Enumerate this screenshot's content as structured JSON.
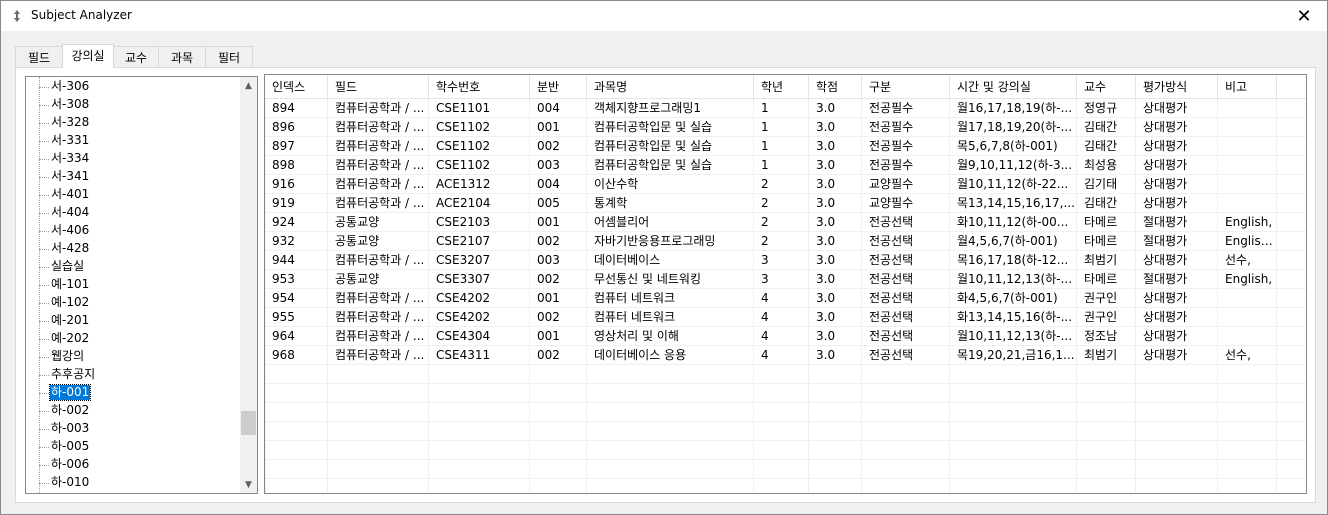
{
  "window": {
    "title": "Subject Analyzer",
    "close_glyph": "✕"
  },
  "tabs": [
    {
      "label": "필드"
    },
    {
      "label": "강의실"
    },
    {
      "label": "교수"
    },
    {
      "label": "과목"
    },
    {
      "label": "필터"
    }
  ],
  "tree": {
    "items": [
      "서-306",
      "서-308",
      "서-328",
      "서-331",
      "서-334",
      "서-341",
      "서-401",
      "서-404",
      "서-406",
      "서-428",
      "실습실",
      "예-101",
      "예-102",
      "예-201",
      "예-202",
      "웹강의",
      "추후공지",
      "하-001",
      "하-002",
      "하-003",
      "하-005",
      "하-006",
      "하-010"
    ],
    "selected": "하-001",
    "scroll_position": 0.8
  },
  "table": {
    "columns": [
      "인덱스",
      "필드",
      "학수번호",
      "분반",
      "과목명",
      "학년",
      "학점",
      "구분",
      "시간 및 강의실",
      "교수",
      "평가방식",
      "비고"
    ],
    "rows": [
      [
        "894",
        "컴퓨터공학과 / ...",
        "CSE1101",
        "004",
        "객체지향프로그래밍1",
        "1",
        "3.0",
        "전공필수",
        "월16,17,18,19(하-...",
        "정영규",
        "상대평가",
        ""
      ],
      [
        "896",
        "컴퓨터공학과 / ...",
        "CSE1102",
        "001",
        "컴퓨터공학입문 및 실습",
        "1",
        "3.0",
        "전공필수",
        "월17,18,19,20(하-...",
        "김태간",
        "상대평가",
        ""
      ],
      [
        "897",
        "컴퓨터공학과 / ...",
        "CSE1102",
        "002",
        "컴퓨터공학입문 및 실습",
        "1",
        "3.0",
        "전공필수",
        "목5,6,7,8(하-001)",
        "김태간",
        "상대평가",
        ""
      ],
      [
        "898",
        "컴퓨터공학과 / ...",
        "CSE1102",
        "003",
        "컴퓨터공학입문 및 실습",
        "1",
        "3.0",
        "전공필수",
        "월9,10,11,12(하-3...",
        "최성용",
        "상대평가",
        ""
      ],
      [
        "916",
        "컴퓨터공학과 / ...",
        "ACE1312",
        "004",
        "이산수학",
        "2",
        "3.0",
        "교양필수",
        "월10,11,12(하-22...",
        "김기태",
        "상대평가",
        ""
      ],
      [
        "919",
        "컴퓨터공학과 / ...",
        "ACE2104",
        "005",
        "통계학",
        "2",
        "3.0",
        "교양필수",
        "목13,14,15,16,17,...",
        "김태간",
        "상대평가",
        ""
      ],
      [
        "924",
        "공통교양",
        "CSE2103",
        "001",
        "어셈블리어",
        "2",
        "3.0",
        "전공선택",
        "화10,11,12(하-00...",
        "타메르",
        "절대평가",
        "English,"
      ],
      [
        "932",
        "공통교양",
        "CSE2107",
        "002",
        "자바기반응용프로그래밍",
        "2",
        "3.0",
        "전공선택",
        "월4,5,6,7(하-001)",
        "타메르",
        "절대평가",
        "English..."
      ],
      [
        "944",
        "컴퓨터공학과 / ...",
        "CSE3207",
        "003",
        "데이터베이스",
        "3",
        "3.0",
        "전공선택",
        "목16,17,18(하-12...",
        "최범기",
        "상대평가",
        "선수,"
      ],
      [
        "953",
        "공통교양",
        "CSE3307",
        "002",
        "무선통신 및 네트워킹",
        "3",
        "3.0",
        "전공선택",
        "월10,11,12,13(하-...",
        "타메르",
        "절대평가",
        "English,"
      ],
      [
        "954",
        "컴퓨터공학과 / ...",
        "CSE4202",
        "001",
        "컴퓨터 네트워크",
        "4",
        "3.0",
        "전공선택",
        "화4,5,6,7(하-001)",
        "권구인",
        "상대평가",
        ""
      ],
      [
        "955",
        "컴퓨터공학과 / ...",
        "CSE4202",
        "002",
        "컴퓨터 네트워크",
        "4",
        "3.0",
        "전공선택",
        "화13,14,15,16(하-...",
        "권구인",
        "상대평가",
        ""
      ],
      [
        "964",
        "컴퓨터공학과 / ...",
        "CSE4304",
        "001",
        "영상처리 및 이해",
        "4",
        "3.0",
        "전공선택",
        "월10,11,12,13(하-...",
        "정조남",
        "상대평가",
        ""
      ],
      [
        "968",
        "컴퓨터공학과 / ...",
        "CSE4311",
        "002",
        "데이터베이스 응용",
        "4",
        "3.0",
        "전공선택",
        "목19,20,21,금16,1...",
        "최범기",
        "상대평가",
        "선수,"
      ]
    ]
  },
  "colors": {
    "selection": "#0078d7",
    "window_bg": "#f0f0f0",
    "border": "#828790"
  }
}
